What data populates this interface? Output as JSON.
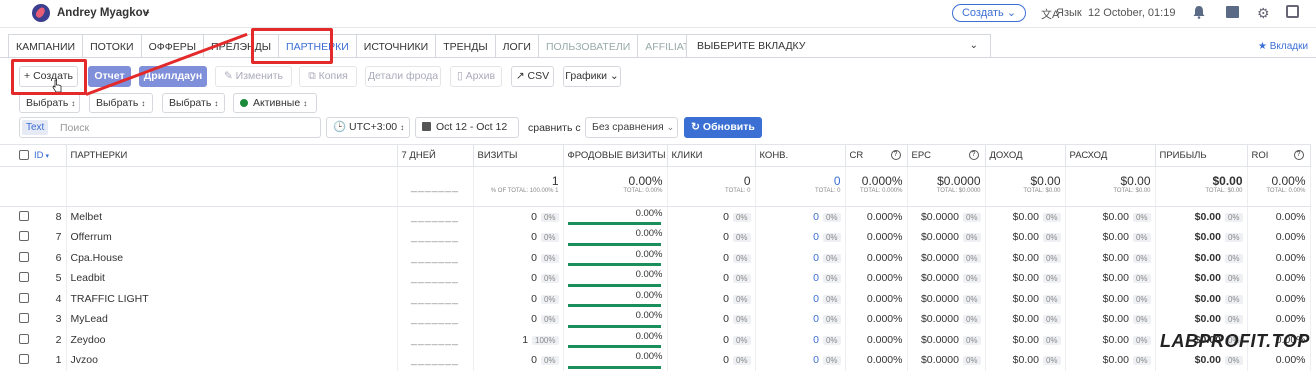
{
  "topbar": {
    "user_name": "Andrey Myagkov",
    "user_caret": "⌄",
    "create_label": "Создать",
    "lang_label": "Язык",
    "lang_icon": "文A",
    "date": "12 October, 01:19",
    "icons": [
      "bell-icon",
      "book-icon",
      "gear-icon",
      "expand-icon"
    ]
  },
  "tabs": [
    {
      "label": "КАМПАНИИ"
    },
    {
      "label": "ПОТОКИ"
    },
    {
      "label": "ОФФЕРЫ"
    },
    {
      "label": "ПРЕЛЭНДЫ"
    },
    {
      "label": "ПАРТНЕРКИ",
      "active": true
    },
    {
      "label": "ИСТОЧНИКИ"
    },
    {
      "label": "ТРЕНДЫ"
    },
    {
      "label": "ЛОГИ"
    },
    {
      "label": "ПОЛЬЗОВАТЕЛИ",
      "disabled": true
    },
    {
      "label": "AFFILIATE PANEL",
      "disabled": true
    }
  ],
  "tab_select": {
    "label": "ВЫБЕРИТЕ ВКЛАДКУ",
    "chevron": "⌄"
  },
  "bookmarks_label": "★ Вкладки",
  "toolbar": {
    "create": "+ Создать",
    "report": "Отчет",
    "drilldown": "Дриллдаун",
    "edit": "✎ Изменить",
    "copy": "⧉ Копия",
    "fraud_details": "Детали фрода",
    "archive": "▯ Архив",
    "csv": "↗ CSV",
    "charts": "Графики ⌄"
  },
  "filters": {
    "select1": "Выбрать",
    "select2": "Выбрать",
    "select3": "Выбрать",
    "status": "Активные",
    "sort_icon": "⌃⌄"
  },
  "search": {
    "type": "Text",
    "placeholder": "Поиск"
  },
  "timezone": "UTC+3:00",
  "date_range": "Oct 12 - Oct 12",
  "compare_label": "сравнить с",
  "compare_value": "Без сравнения",
  "refresh": "Обновить",
  "columns": [
    "ID",
    "ПАРТНЕРКИ",
    "7 ДНЕЙ",
    "ВИЗИТЫ",
    "ФРОДОВЫЕ ВИЗИТЫ",
    "КЛИКИ",
    "КОНВ.",
    "CR",
    "EPC",
    "ДОХОД",
    "РАСХОД",
    "ПРИБЫЛЬ",
    "ROI"
  ],
  "totals": {
    "visits": "1",
    "visits_sub": "% OF TOTAL: 100.00% 1",
    "fraud": "0.00%",
    "fraud_sub": "TOTAL: 0.00%",
    "clicks": "0",
    "clicks_sub": "TOTAL: 0",
    "conv": "0",
    "conv_sub": "TOTAL: 0",
    "cr": "0.000%",
    "cr_sub": "TOTAL: 0.000%",
    "epc": "$0.0000",
    "epc_sub": "TOTAL: $0.0000",
    "revenue": "$0.00",
    "revenue_sub": "TOTAL: $0.00",
    "cost": "$0.00",
    "cost_sub": "TOTAL: $0.00",
    "profit": "$0.00",
    "profit_sub": "TOTAL: $0.00",
    "roi": "0.00%",
    "roi_sub": "TOTAL: 0.00%",
    "spark": "_______"
  },
  "rows": [
    {
      "id": "8",
      "name": "Melbet",
      "visits": "0",
      "visits_pct": "0%",
      "fraud": "0.00%",
      "clicks": "0",
      "clicks_pct": "0%",
      "conv": "0",
      "conv_pct": "0%",
      "cr": "0.000%",
      "epc": "$0.0000",
      "epc_pct": "0%",
      "rev": "$0.00",
      "rev_pct": "0%",
      "cost": "$0.00",
      "cost_pct": "0%",
      "profit": "$0.00",
      "profit_pct": "0%",
      "roi": "0.00%"
    },
    {
      "id": "7",
      "name": "Offerrum",
      "visits": "0",
      "visits_pct": "0%",
      "fraud": "0.00%",
      "clicks": "0",
      "clicks_pct": "0%",
      "conv": "0",
      "conv_pct": "0%",
      "cr": "0.000%",
      "epc": "$0.0000",
      "epc_pct": "0%",
      "rev": "$0.00",
      "rev_pct": "0%",
      "cost": "$0.00",
      "cost_pct": "0%",
      "profit": "$0.00",
      "profit_pct": "0%",
      "roi": "0.00%"
    },
    {
      "id": "6",
      "name": "Cpa.House",
      "visits": "0",
      "visits_pct": "0%",
      "fraud": "0.00%",
      "clicks": "0",
      "clicks_pct": "0%",
      "conv": "0",
      "conv_pct": "0%",
      "cr": "0.000%",
      "epc": "$0.0000",
      "epc_pct": "0%",
      "rev": "$0.00",
      "rev_pct": "0%",
      "cost": "$0.00",
      "cost_pct": "0%",
      "profit": "$0.00",
      "profit_pct": "0%",
      "roi": "0.00%"
    },
    {
      "id": "5",
      "name": "Leadbit",
      "visits": "0",
      "visits_pct": "0%",
      "fraud": "0.00%",
      "clicks": "0",
      "clicks_pct": "0%",
      "conv": "0",
      "conv_pct": "0%",
      "cr": "0.000%",
      "epc": "$0.0000",
      "epc_pct": "0%",
      "rev": "$0.00",
      "rev_pct": "0%",
      "cost": "$0.00",
      "cost_pct": "0%",
      "profit": "$0.00",
      "profit_pct": "0%",
      "roi": "0.00%"
    },
    {
      "id": "4",
      "name": "TRAFFIC LIGHT",
      "visits": "0",
      "visits_pct": "0%",
      "fraud": "0.00%",
      "clicks": "0",
      "clicks_pct": "0%",
      "conv": "0",
      "conv_pct": "0%",
      "cr": "0.000%",
      "epc": "$0.0000",
      "epc_pct": "0%",
      "rev": "$0.00",
      "rev_pct": "0%",
      "cost": "$0.00",
      "cost_pct": "0%",
      "profit": "$0.00",
      "profit_pct": "0%",
      "roi": "0.00%"
    },
    {
      "id": "3",
      "name": "MyLead",
      "visits": "0",
      "visits_pct": "0%",
      "fraud": "0.00%",
      "clicks": "0",
      "clicks_pct": "0%",
      "conv": "0",
      "conv_pct": "0%",
      "cr": "0.000%",
      "epc": "$0.0000",
      "epc_pct": "0%",
      "rev": "$0.00",
      "rev_pct": "0%",
      "cost": "$0.00",
      "cost_pct": "0%",
      "profit": "$0.00",
      "profit_pct": "0%",
      "roi": "0.00%"
    },
    {
      "id": "2",
      "name": "Zeydoo",
      "visits": "1",
      "visits_pct": "100%",
      "fraud": "0.00%",
      "clicks": "0",
      "clicks_pct": "0%",
      "conv": "0",
      "conv_pct": "0%",
      "cr": "0.000%",
      "epc": "$0.0000",
      "epc_pct": "0%",
      "rev": "$0.00",
      "rev_pct": "0%",
      "cost": "$0.00",
      "cost_pct": "0%",
      "profit": "$0.00",
      "profit_pct": "0%",
      "roi": "0.00%"
    },
    {
      "id": "1",
      "name": "Jvzoo",
      "visits": "0",
      "visits_pct": "0%",
      "fraud": "0.00%",
      "clicks": "0",
      "clicks_pct": "0%",
      "conv": "0",
      "conv_pct": "0%",
      "cr": "0.000%",
      "epc": "$0.0000",
      "epc_pct": "0%",
      "rev": "$0.00",
      "rev_pct": "0%",
      "cost": "$0.00",
      "cost_pct": "0%",
      "profit": "$0.00",
      "profit_pct": "0%",
      "roi": "0.00%"
    }
  ],
  "watermark": "LABPROFIT.TOP",
  "colors": {
    "accent": "#3b6fd4",
    "annotation": "#e32929",
    "fraud_bar": "#1a8f5c",
    "status_active": "#1b8a3a"
  }
}
